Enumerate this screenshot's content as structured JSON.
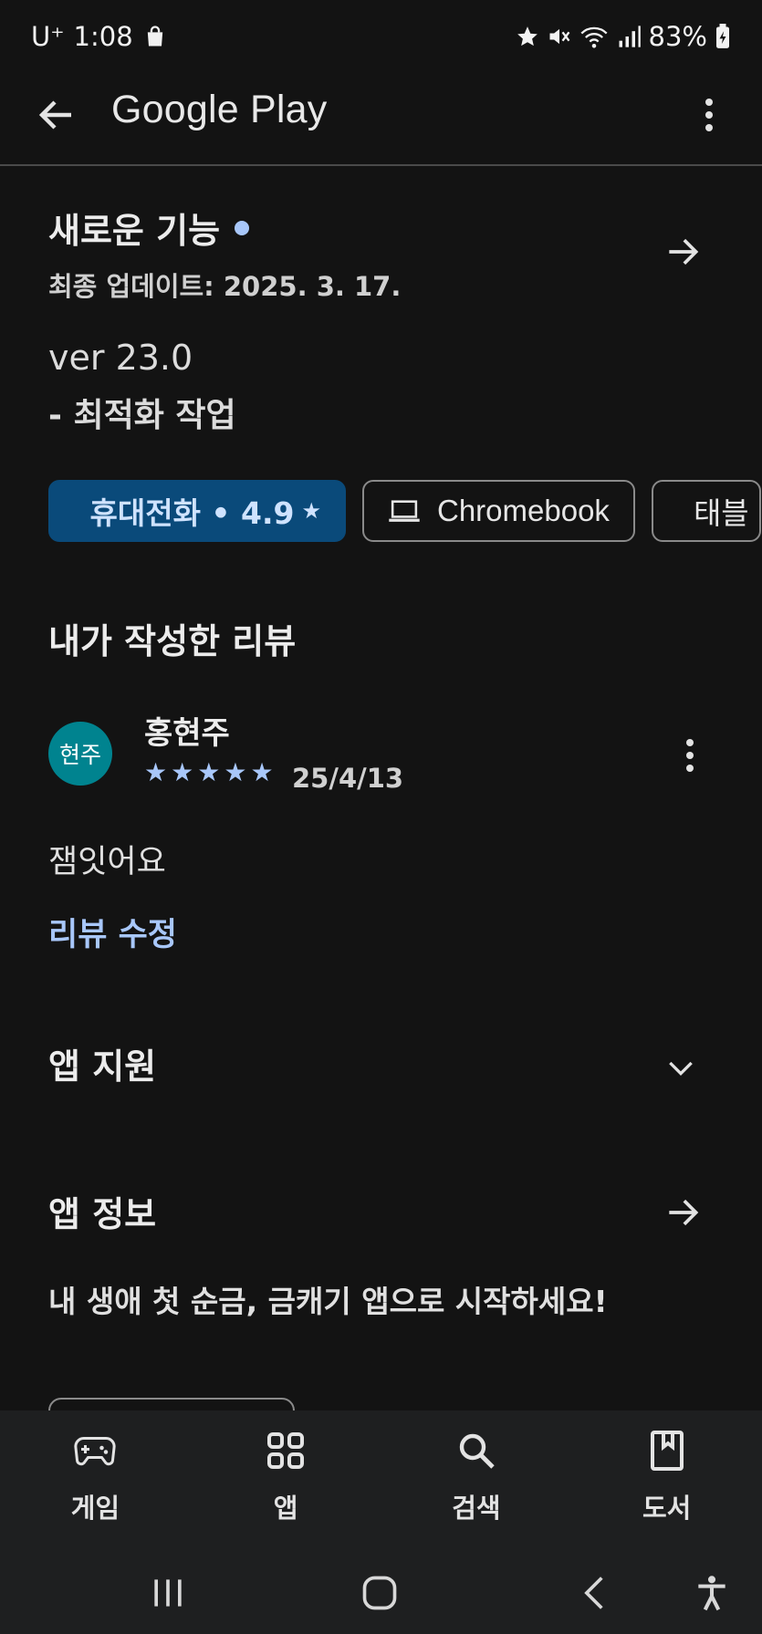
{
  "status_bar": {
    "carrier": "U⁺",
    "time": "1:08",
    "battery": "83%"
  },
  "app_bar": {
    "title": "Google Play"
  },
  "whats_new": {
    "title": "새로운 기능",
    "last_updated": "최종 업데이트: 2025. 3. 17.",
    "version": "ver 23.0",
    "note": "- 최적화 작업"
  },
  "device_chips": [
    {
      "label": "휴대전화 • 4.9",
      "selected": true
    },
    {
      "label": "Chromebook",
      "selected": false
    },
    {
      "label": "태블",
      "selected": false
    }
  ],
  "my_review": {
    "title": "내가 작성한 리뷰",
    "avatar_text": "현주",
    "reviewer": "홍현주",
    "rating": 5,
    "date": "25/4/13",
    "text": "잼잇어요",
    "edit_label": "리뷰 수정"
  },
  "app_support": {
    "title": "앱 지원"
  },
  "app_info": {
    "title": "앱 정보",
    "description": "내 생애 첫 순금, 금캐기 앱으로 시작하세요!"
  },
  "bottom_nav": [
    {
      "label": "게임",
      "icon": "gamepad-icon"
    },
    {
      "label": "앱",
      "icon": "apps-grid-icon"
    },
    {
      "label": "검색",
      "icon": "search-icon"
    },
    {
      "label": "도서",
      "icon": "book-icon"
    }
  ],
  "colors": {
    "background": "#131313",
    "accent": "#a8c7fa",
    "chip_selected": "#0a4a7a",
    "avatar": "#00838f"
  }
}
